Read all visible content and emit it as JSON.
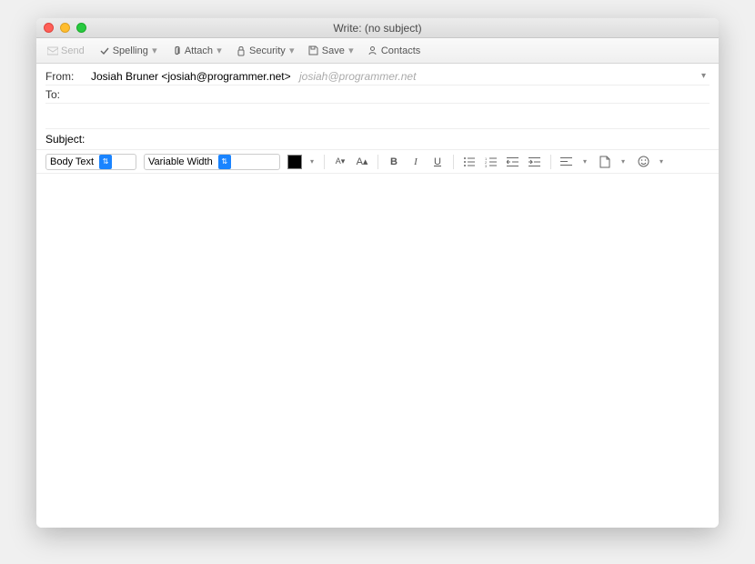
{
  "window": {
    "title": "Write: (no subject)"
  },
  "toolbar": {
    "send": "Send",
    "spelling": "Spelling",
    "attach": "Attach",
    "security": "Security",
    "save": "Save",
    "contacts": "Contacts"
  },
  "headers": {
    "from_label": "From:",
    "from_value": "Josiah Bruner <josiah@programmer.net>",
    "from_hint": "josiah@programmer.net",
    "to_label": "To:",
    "to_value": ""
  },
  "subject": {
    "label": "Subject:",
    "value": ""
  },
  "format": {
    "style": "Body Text",
    "font": "Variable Width",
    "color": "#000000"
  }
}
